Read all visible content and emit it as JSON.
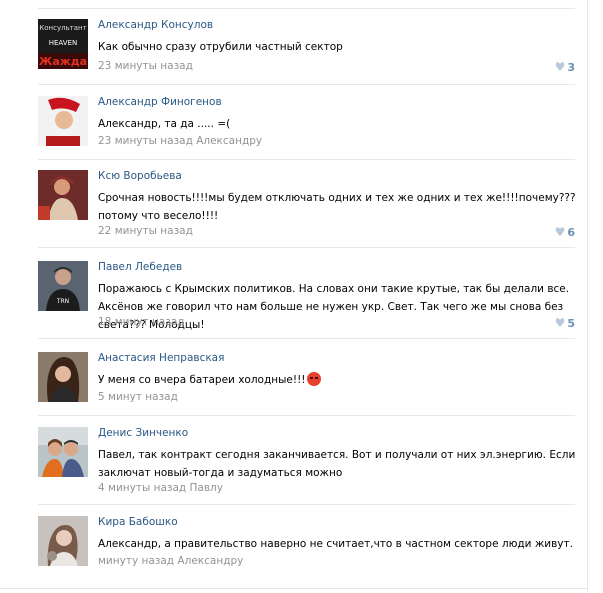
{
  "comments": [
    {
      "author": "Александр Консулов",
      "text": "Как обычно сразу отрубили частный сектор",
      "time": "23 минуты назад",
      "reply": "",
      "likes": "3",
      "avatar_text_top": "Консультант",
      "avatar_text_mid": "HEAVEN",
      "avatar_text_bot": "Жажда"
    },
    {
      "author": "Александр Финогенов",
      "text": "Александр, та да ..... =(",
      "time": "23 минуты назад",
      "reply": "Александру",
      "likes": ""
    },
    {
      "author": "Ксю Воробьева",
      "text": "Срочная новость!!!!мы будем отключать одних и тех же одних и тех же!!!!почему???потому что весело!!!!",
      "time": "22 минуты назад",
      "reply": "",
      "likes": "6"
    },
    {
      "author": "Павел Лебедев",
      "text": "Поражаюсь с Крымских политиков. На словах они такие крутые, так бы делали все. Аксёнов же говорил что нам больше не нужен укр. Свет. Так чего же мы снова без света??? Молодцы!",
      "time": "18 минут назад",
      "reply": "",
      "likes": "5",
      "avatar_shirt_text": "TRN"
    },
    {
      "author": "Анастасия Неправская",
      "text": "У меня со вчера батареи холодные!!!",
      "time": "5 минут назад",
      "reply": "",
      "likes": "",
      "emoji": "angry-face"
    },
    {
      "author": "Денис Зинченко",
      "text": "Павел, так контракт сегодня заканчивается. Вот и получали от них эл.энергию. Если заключат новый-тогда и задуматься можно",
      "time": "4 минуты назад",
      "reply": "Павлу",
      "likes": ""
    },
    {
      "author": "Кира Бабошко",
      "text": "Александр, а правительство наверно не считает,что в частном секторе люди живут.",
      "time": "минуту назад",
      "reply": "Александру",
      "likes": ""
    }
  ],
  "colors": {
    "author": "#2a5885",
    "meta": "#939393",
    "likes": "#6d8fb3",
    "divider": "#e7e8ec"
  }
}
